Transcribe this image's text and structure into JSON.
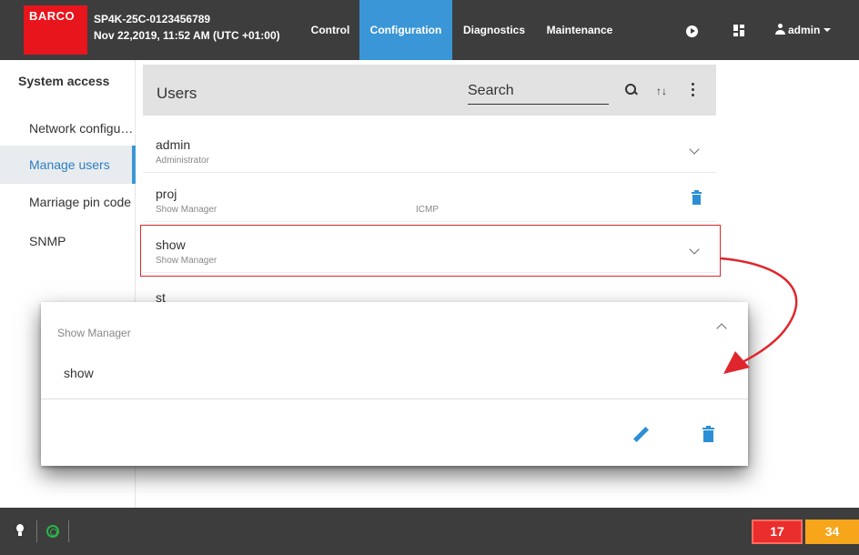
{
  "topbar": {
    "brand": "BARCO",
    "device_name": "SP4K-25C-0123456789",
    "datetime": "Nov 22,2019, 11:52 AM (UTC +01:00)",
    "tabs": [
      {
        "label": "Control",
        "active": false
      },
      {
        "label": "Configuration",
        "active": true
      },
      {
        "label": "Diagnostics",
        "active": false
      },
      {
        "label": "Maintenance",
        "active": false
      }
    ],
    "user_label": "admin",
    "icons": [
      "play-icon",
      "layout-icon",
      "person-icon",
      "caret-down-icon"
    ]
  },
  "sidebar": {
    "header": "System access",
    "items": [
      {
        "label": "Network configur…",
        "active": false
      },
      {
        "label": "Manage users",
        "active": true
      },
      {
        "label": "Marriage pin code",
        "active": false
      },
      {
        "label": "SNMP",
        "active": false
      }
    ]
  },
  "users_panel": {
    "title": "Users",
    "search_placeholder": "Search",
    "icons": [
      "search-icon",
      "sort-icon",
      "more-icon"
    ]
  },
  "users": [
    {
      "name": "admin",
      "role": "Administrator",
      "extra": "",
      "action": "chevron-down-icon"
    },
    {
      "name": "proj",
      "role": "Show Manager",
      "extra": "ICMP",
      "action": "trash-icon"
    },
    {
      "name": "show",
      "role": "Show Manager",
      "extra": "",
      "action": "chevron-down-icon",
      "highlighted": true
    },
    {
      "name": "st",
      "role": "",
      "extra": "",
      "action": ""
    }
  ],
  "detail_card": {
    "role": "Show Manager",
    "name": "show",
    "actions": [
      "edit-icon",
      "trash-icon"
    ]
  },
  "statusbar": {
    "error_count": "17",
    "warning_count": "34",
    "icons": [
      "bulb-icon",
      "status-ring-icon"
    ]
  },
  "colors": {
    "topbar_bg": "#3d3d3d",
    "brand_red": "#e8151d",
    "accent_blue": "#3a96d6",
    "highlight_red": "#e0262d",
    "error": "#ea2d2d",
    "warning": "#f7a61c",
    "ok_green": "#2ab54a"
  }
}
